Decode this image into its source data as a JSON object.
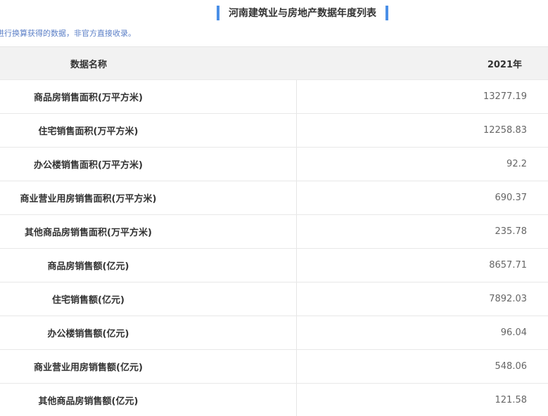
{
  "title": "河南建筑业与房地产数据年度列表",
  "note": "进行换算获得的数据，非官方直接收录。",
  "colors": {
    "accent": "#4a8fe7",
    "note": "#5b7fc7"
  },
  "table": {
    "header": {
      "name": "数据名称",
      "year": "2021年"
    },
    "rows": [
      {
        "name": "商品房销售面积(万平方米)",
        "value": "13277.19"
      },
      {
        "name": "住宅销售面积(万平方米)",
        "value": "12258.83"
      },
      {
        "name": "办公楼销售面积(万平方米)",
        "value": "92.2"
      },
      {
        "name": "商业营业用房销售面积(万平方米)",
        "value": "690.37"
      },
      {
        "name": "其他商品房销售面积(万平方米)",
        "value": "235.78"
      },
      {
        "name": "商品房销售额(亿元)",
        "value": "8657.71"
      },
      {
        "name": "住宅销售额(亿元)",
        "value": "7892.03"
      },
      {
        "name": "办公楼销售额(亿元)",
        "value": "96.04"
      },
      {
        "name": "商业营业用房销售额(亿元)",
        "value": "548.06"
      },
      {
        "name": "其他商品房销售额(亿元)",
        "value": "121.58"
      }
    ]
  }
}
